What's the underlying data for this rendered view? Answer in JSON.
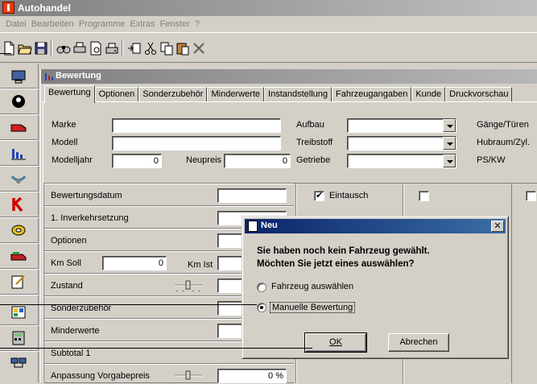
{
  "app": {
    "title": "Autohandel"
  },
  "menu": [
    "Datei",
    "Bearbeiten",
    "Programme",
    "Extras",
    "Fenster",
    "?"
  ],
  "child": {
    "title": "Bewertung"
  },
  "tabs": [
    "Bewertung",
    "Optionen",
    "Sonderzubehör",
    "Minderwerte",
    "Instandstellung",
    "Fahrzeugangaben",
    "Kunde",
    "Druckvorschau"
  ],
  "form": {
    "marke_label": "Marke",
    "modell_label": "Modell",
    "modelljahr_label": "Modelljahr",
    "modelljahr_value": "0",
    "neupreis_label": "Neupreis",
    "neupreis_value": "0",
    "aufbau_label": "Aufbau",
    "treibstoff_label": "Treibstoff",
    "getriebe_label": "Getriebe",
    "gaenge_label": "Gänge/Türen",
    "hubraum_label": "Hubraum/Zyl.",
    "pskw_label": "PS/KW"
  },
  "grid": {
    "rows": [
      {
        "label": "Bewertungsdatum"
      },
      {
        "label": "1. Inverkehrsetzung"
      },
      {
        "label": "Optionen"
      },
      {
        "label": "Km Soll"
      },
      {
        "label": "Zustand"
      },
      {
        "label": "Sonderzubehör"
      },
      {
        "label": "Minderwerte"
      },
      {
        "label": "Subtotal 1"
      },
      {
        "label": "Anpassung Vorgabepreis"
      }
    ],
    "km_soll_value": "0",
    "km_ist_label": "Km Ist",
    "anpassung_value": "0 %",
    "eintausch_label": "Eintausch",
    "eintausch_checked": true
  },
  "dialog": {
    "title": "Neu",
    "message_line1": "Sie haben noch kein Fahrzeug gewählt.",
    "message_line2": "Möchten Sie jetzt eines auswählen?",
    "option1": "Fahrzeug auswählen",
    "option2": "Manuelle Bewertung",
    "selected": "option2",
    "ok_label": "OK",
    "cancel_label": "Abrechen"
  }
}
